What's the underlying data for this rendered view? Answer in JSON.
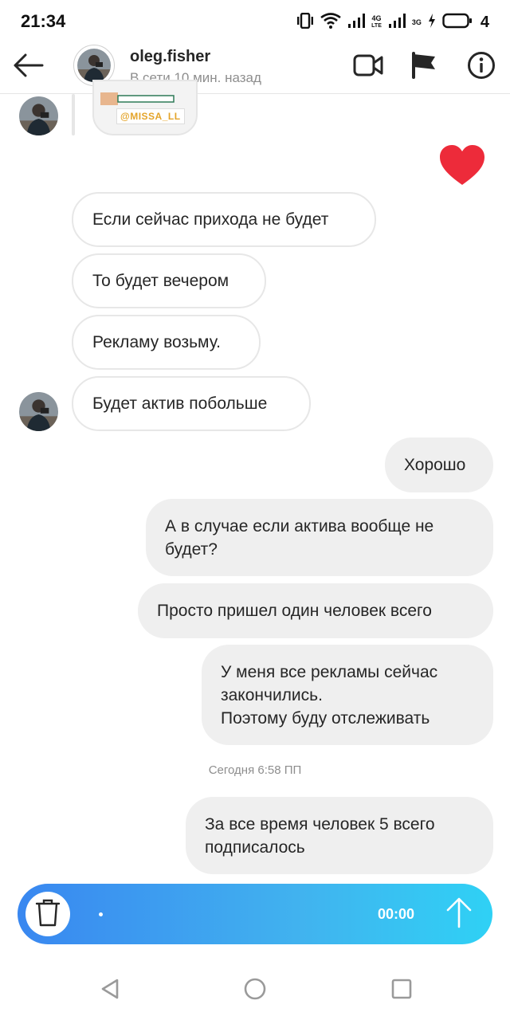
{
  "status_bar": {
    "time": "21:34",
    "network_1": "4G",
    "network_1_sub": "LTE",
    "network_2": "3G",
    "battery": "4"
  },
  "header": {
    "username": "oleg.fisher",
    "status": "В сети 10 мин. назад",
    "icons": [
      "arrow-left-icon",
      "video-camera-icon",
      "flag-icon",
      "info-icon"
    ]
  },
  "story_preview": {
    "tag": "@MISSA_LL"
  },
  "reaction": {
    "icon": "heart-icon",
    "color": "#ed2b3a"
  },
  "messages": {
    "incoming": [
      "Если сейчас прихода не будет",
      "То будет вечером",
      "Рекламу возьму.",
      "Будет актив побольше"
    ],
    "outgoing": [
      {
        "lines": [
          "Хорошо"
        ]
      },
      {
        "lines": [
          "А в случае если актива вообще не",
          "будет?"
        ]
      },
      {
        "lines": [
          "Просто пришел один человек всего"
        ]
      },
      {
        "lines": [
          "У меня все рекламы сейчас",
          "закончились.",
          "Поэтому буду отслеживать"
        ]
      },
      {
        "lines": [
          "За все время человек 5 всего",
          "подписалось"
        ]
      }
    ]
  },
  "timestamp": "Сегодня 6:58 ПП",
  "recorder": {
    "timer": "00:00",
    "gradient_start": "#3987f0",
    "gradient_end": "#2fd1f5"
  },
  "colors": {
    "incoming_border": "#e7e7e7",
    "outgoing_bg": "#efefef",
    "muted_text": "#8e8e8e"
  }
}
